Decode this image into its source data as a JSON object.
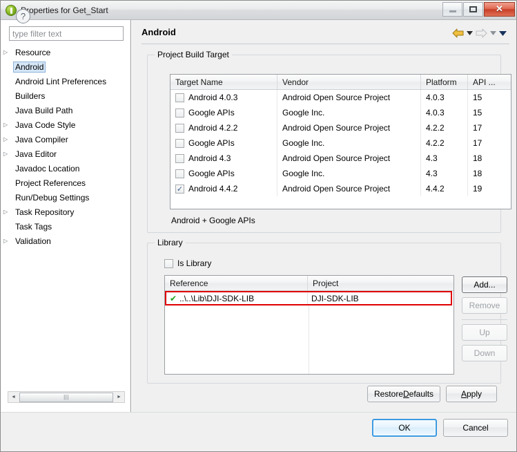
{
  "window": {
    "title": "Properties for Get_Start",
    "icon": "eclipse-icon",
    "minimize_label": "",
    "maximize_label": "",
    "close_label": "✕"
  },
  "sidebar": {
    "filter_placeholder": "type filter text",
    "filter_value": "",
    "items": [
      {
        "label": "Resource",
        "expandable": true,
        "selected": false
      },
      {
        "label": "Android",
        "expandable": false,
        "selected": true
      },
      {
        "label": "Android Lint Preferences",
        "expandable": false,
        "selected": false
      },
      {
        "label": "Builders",
        "expandable": false,
        "selected": false
      },
      {
        "label": "Java Build Path",
        "expandable": false,
        "selected": false
      },
      {
        "label": "Java Code Style",
        "expandable": true,
        "selected": false
      },
      {
        "label": "Java Compiler",
        "expandable": true,
        "selected": false
      },
      {
        "label": "Java Editor",
        "expandable": true,
        "selected": false
      },
      {
        "label": "Javadoc Location",
        "expandable": false,
        "selected": false
      },
      {
        "label": "Project References",
        "expandable": false,
        "selected": false
      },
      {
        "label": "Run/Debug Settings",
        "expandable": false,
        "selected": false
      },
      {
        "label": "Task Repository",
        "expandable": true,
        "selected": false
      },
      {
        "label": "Task Tags",
        "expandable": false,
        "selected": false
      },
      {
        "label": "Validation",
        "expandable": true,
        "selected": false
      }
    ],
    "scrollbar": {
      "left_arrow": "◄",
      "right_arrow": "►",
      "grip": "|||"
    }
  },
  "page": {
    "title": "Android",
    "nav": {
      "back_icon": "back-arrow-icon",
      "back_menu_icon": "chevron-down-icon",
      "forward_icon": "forward-arrow-icon",
      "forward_menu_icon": "chevron-down-icon",
      "view_menu_icon": "chevron-down-icon"
    }
  },
  "build_target": {
    "group_title": "Project Build Target",
    "columns": [
      "Target Name",
      "Vendor",
      "Platform",
      "API ..."
    ],
    "rows": [
      {
        "checked": false,
        "name": "Android 4.0.3",
        "vendor": "Android Open Source Project",
        "platform": "4.0.3",
        "api": "15"
      },
      {
        "checked": false,
        "name": "Google APIs",
        "vendor": "Google Inc.",
        "platform": "4.0.3",
        "api": "15"
      },
      {
        "checked": false,
        "name": "Android 4.2.2",
        "vendor": "Android Open Source Project",
        "platform": "4.2.2",
        "api": "17"
      },
      {
        "checked": false,
        "name": "Google APIs",
        "vendor": "Google Inc.",
        "platform": "4.2.2",
        "api": "17"
      },
      {
        "checked": false,
        "name": "Android 4.3",
        "vendor": "Android Open Source Project",
        "platform": "4.3",
        "api": "18"
      },
      {
        "checked": false,
        "name": "Google APIs",
        "vendor": "Google Inc.",
        "platform": "4.3",
        "api": "18"
      },
      {
        "checked": true,
        "name": "Android 4.4.2",
        "vendor": "Android Open Source Project",
        "platform": "4.4.2",
        "api": "19"
      }
    ],
    "summary": "Android + Google APIs"
  },
  "library": {
    "group_title": "Library",
    "is_library_label": "Is Library",
    "is_library_checked": false,
    "columns": [
      "Reference",
      "Project"
    ],
    "rows": [
      {
        "status_icon": "green-check-icon",
        "reference": "..\\..\\Lib\\DJI-SDK-LIB",
        "project": "DJI-SDK-LIB",
        "highlighted": true
      }
    ],
    "buttons": {
      "add": {
        "label": "Add...",
        "enabled": true
      },
      "remove": {
        "label": "Remove",
        "enabled": false
      },
      "up": {
        "label": "Up",
        "enabled": false
      },
      "down": {
        "label": "Down",
        "enabled": false
      }
    }
  },
  "page_buttons": {
    "restore_defaults": {
      "pre": "Restore ",
      "mnemonic": "D",
      "post": "efaults"
    },
    "apply": {
      "pre": "",
      "mnemonic": "A",
      "post": "pply"
    }
  },
  "footer": {
    "help_icon": "question-mark-icon",
    "ok_label": "OK",
    "cancel_label": "Cancel"
  },
  "colors": {
    "accent_focus": "#3b9ae1",
    "highlight_row_border": "#e00000",
    "check_green": "#1aa01a",
    "selection_blue": "#d5e6f7",
    "title_icon_green": "#8dbd2a"
  }
}
